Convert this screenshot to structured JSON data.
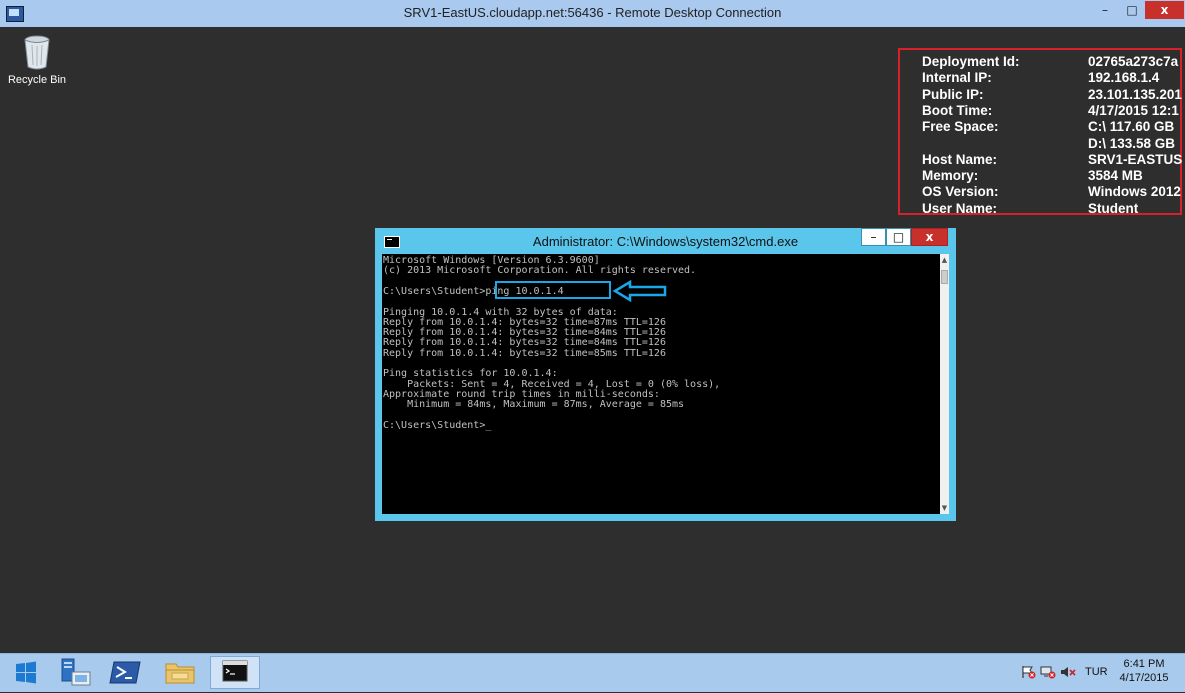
{
  "rdp_window": {
    "title": "SRV1-EastUS.cloudapp.net:56436 - Remote Desktop Connection",
    "minimize": "–",
    "maximize": "□",
    "close": "x"
  },
  "desktop": {
    "recycle_bin_label": "Recycle Bin"
  },
  "bginfo": {
    "rows": [
      {
        "key": "Deployment Id:",
        "value": "02765a273c7a"
      },
      {
        "key": "Internal IP:",
        "value": "192.168.1.4"
      },
      {
        "key": "Public IP:",
        "value": "23.101.135.201"
      },
      {
        "key": "Boot Time:",
        "value": "4/17/2015 12:1"
      },
      {
        "key": "Free Space:",
        "value": "C:\\ 117.60 GB"
      },
      {
        "key": "",
        "value": "D:\\ 133.58 GB"
      },
      {
        "key": "Host Name:",
        "value": "SRV1-EASTUS"
      },
      {
        "key": "Memory:",
        "value": "3584 MB"
      },
      {
        "key": "OS Version:",
        "value": "Windows 2012"
      },
      {
        "key": "User Name:",
        "value": "Student"
      }
    ]
  },
  "cmd_window": {
    "title": "Administrator: C:\\Windows\\system32\\cmd.exe",
    "minimize": "–",
    "maximize": "□",
    "close": "x",
    "lines": [
      "Microsoft Windows [Version 6.3.9600]",
      "(c) 2013 Microsoft Corporation. All rights reserved.",
      "",
      "C:\\Users\\Student>ping 10.0.1.4",
      "",
      "Pinging 10.0.1.4 with 32 bytes of data:",
      "Reply from 10.0.1.4: bytes=32 time=87ms TTL=126",
      "Reply from 10.0.1.4: bytes=32 time=84ms TTL=126",
      "Reply from 10.0.1.4: bytes=32 time=84ms TTL=126",
      "Reply from 10.0.1.4: bytes=32 time=85ms TTL=126",
      "",
      "Ping statistics for 10.0.1.4:",
      "    Packets: Sent = 4, Received = 4, Lost = 0 (0% loss),",
      "Approximate round trip times in milli-seconds:",
      "    Minimum = 84ms, Maximum = 87ms, Average = 85ms",
      "",
      "C:\\Users\\Student>_"
    ]
  },
  "taskbar": {
    "language": "TUR",
    "time": "6:41 PM",
    "date": "4/17/2015"
  },
  "colors": {
    "highlight_box": "#1aa7e8",
    "bginfo_border": "#d7202a",
    "cmd_frame": "#5bc6eb"
  }
}
